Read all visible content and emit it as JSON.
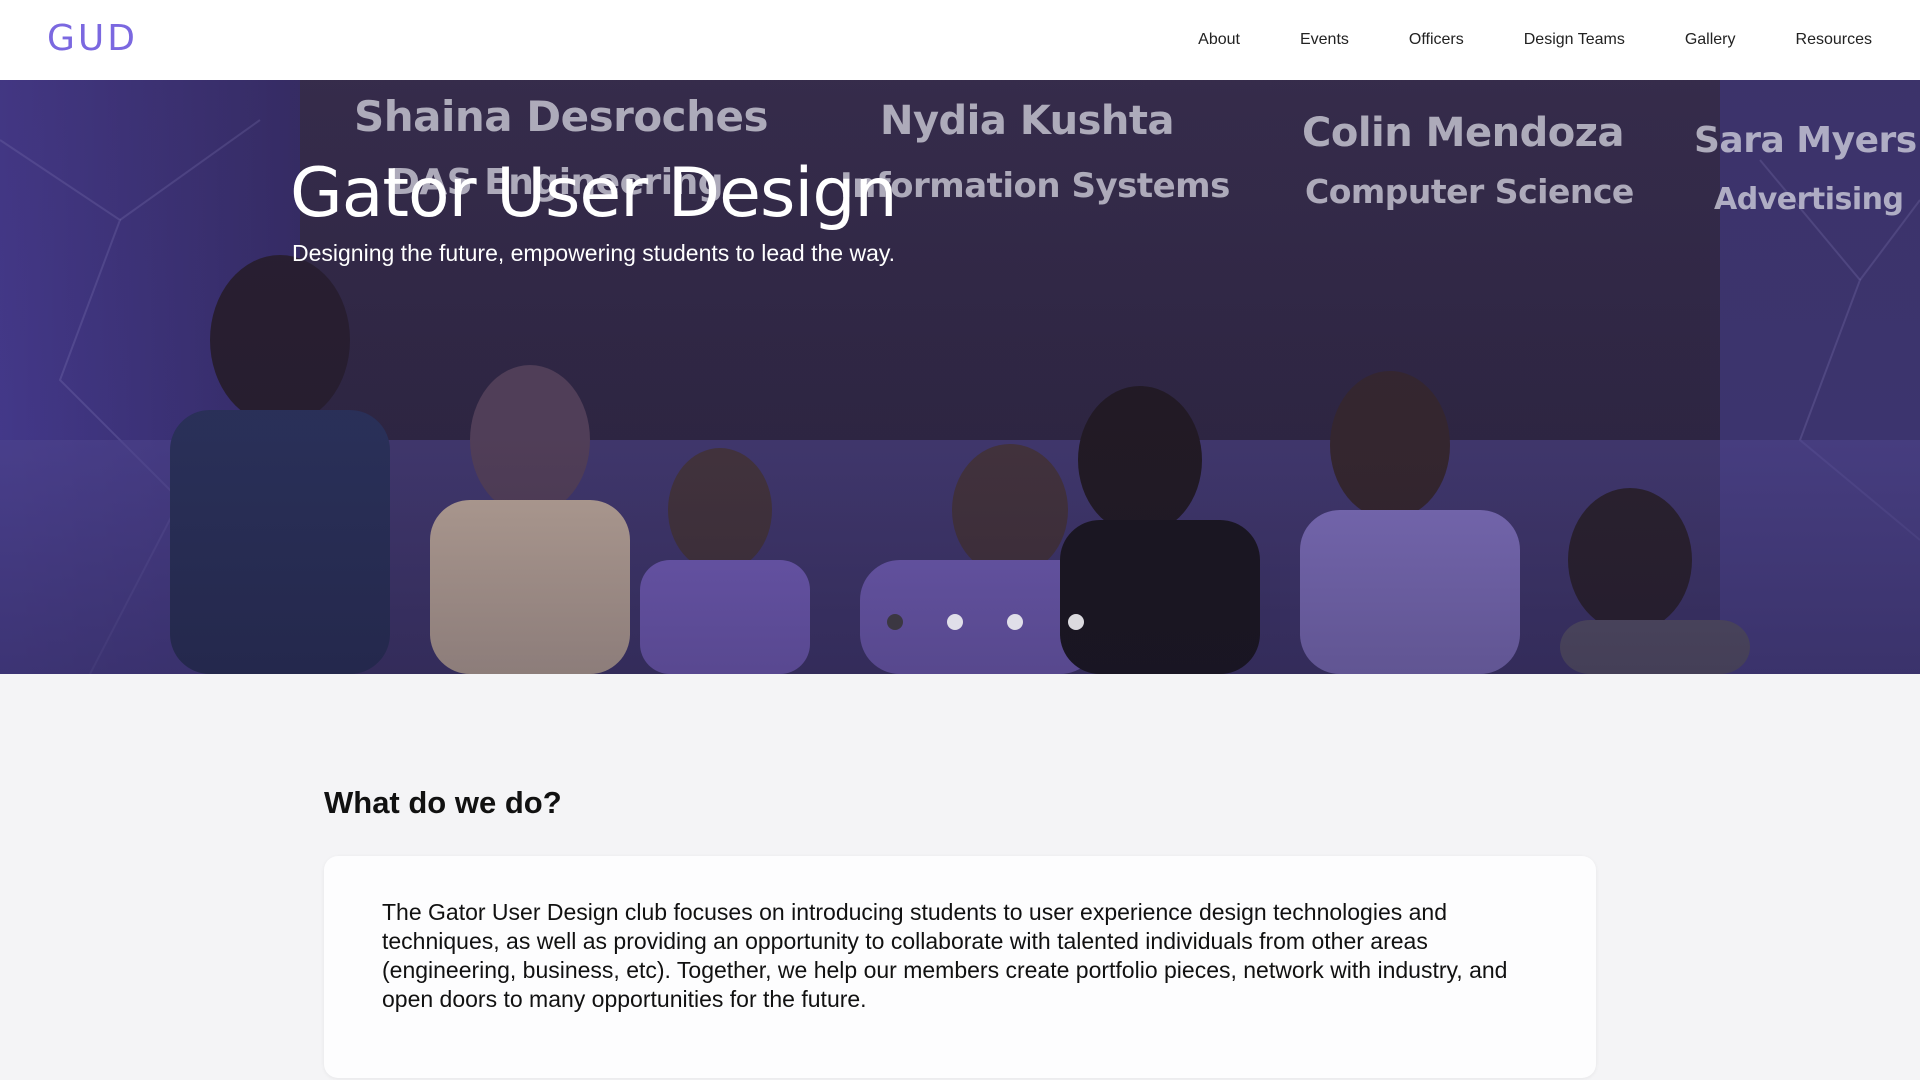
{
  "header": {
    "logo_text": "GUD",
    "nav": [
      "About",
      "Events",
      "Officers",
      "Design Teams",
      "Gallery",
      "Resources"
    ]
  },
  "hero": {
    "title": "Gator User Design",
    "subtitle": "Designing the future, empowering students to lead the way.",
    "background_names": [
      {
        "name": "Shaina Desroches",
        "major": "DAS Engineering"
      },
      {
        "name": "Nydia Kushta",
        "major": "Information Systems"
      },
      {
        "name": "Colin Mendoza",
        "major": "Computer Science"
      },
      {
        "name": "Sara Myers",
        "major": "Advertising"
      }
    ],
    "carousel": {
      "total": 4,
      "active_index": 0
    }
  },
  "about": {
    "heading": "What do we do?",
    "body": "The Gator User Design club focuses on introducing students to user experience design technologies and techniques, as well as providing an opportunity to collaborate with talented individuals from other areas (engineering, business, etc). Together, we help our members create portfolio pieces, network with industry, and open doors to many opportunities for the future."
  },
  "colors": {
    "brand": "#7b68e0",
    "hero_overlay": "#3e3478",
    "page_bg": "#f4f4f6"
  }
}
